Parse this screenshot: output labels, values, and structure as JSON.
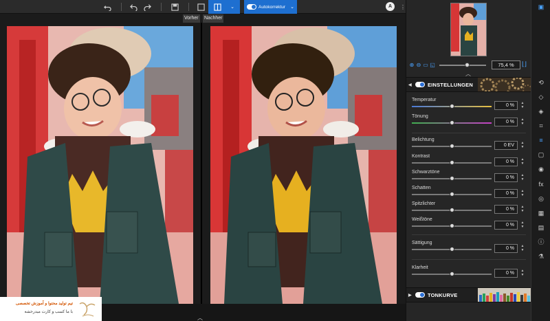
{
  "toolbar": {
    "icons": [
      "undo-all-icon",
      "undo-icon",
      "redo-icon",
      "save-icon",
      "single-view-icon",
      "split-view-icon",
      "chevron-down-icon"
    ],
    "autokorrektur_label": "Autokorrektur",
    "avatar_letter": "A"
  },
  "compare": {
    "before_label": "Vorher",
    "after_label": "Nachher"
  },
  "navigator": {
    "zoom_value": "75,4 %",
    "zoom_level": 0.6
  },
  "sections": {
    "einstellungen": "EINSTELLUNGEN",
    "tonkurve": "TONKURVE"
  },
  "sliders": [
    {
      "label": "Temperatur",
      "value": "0 %",
      "position": 0.5
    },
    {
      "label": "Tönung",
      "value": "0 %",
      "position": 0.5
    },
    {
      "label": "Belichtung",
      "value": "0 EV",
      "position": 0.5
    },
    {
      "label": "Kontrast",
      "value": "0 %",
      "position": 0.5
    },
    {
      "label": "Schwarztöne",
      "value": "0 %",
      "position": 0.5
    },
    {
      "label": "Schatten",
      "value": "0 %",
      "position": 0.5
    },
    {
      "label": "Spitzlichter",
      "value": "0 %",
      "position": 0.5
    },
    {
      "label": "Weißtöne",
      "value": "0 %",
      "position": 0.5
    },
    {
      "label": "Sättigung",
      "value": "0 %",
      "position": 0.5
    },
    {
      "label": "Klarheit",
      "value": "0 %",
      "position": 0.5
    }
  ],
  "tools": [
    "panel-icon",
    "crop-rotate-icon",
    "eraser-icon",
    "bucket-icon",
    "crop-icon",
    "adjust-icon",
    "frame-icon",
    "eye-icon",
    "fx-icon",
    "layers-icon",
    "texture-icon",
    "grid-icon",
    "info-icon",
    "flask-icon"
  ],
  "watermark": {
    "line1": "تیم تولید محتوا و آموزش تخصصی",
    "line2": "با ما کسب و کارت میدرخشه"
  },
  "colors": {
    "accent": "#1e6fd0",
    "panel": "#262626",
    "background": "#1b1b1b"
  }
}
